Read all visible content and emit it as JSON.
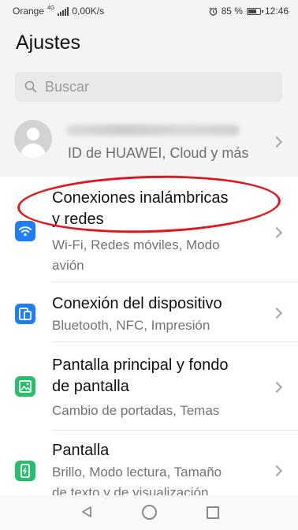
{
  "status_bar": {
    "carrier": "Orange",
    "network": "4G",
    "speed": "0,00K/s",
    "battery": "85 %",
    "battery_level": 0.85,
    "time": "12:46"
  },
  "header": {
    "title": "Ajustes",
    "search_placeholder": "Buscar"
  },
  "account": {
    "subtitle": "ID de HUAWEI, Cloud y más"
  },
  "items": [
    {
      "title_lines": [
        "Conexiones inalámbricas",
        "y redes"
      ],
      "subtitle_lines": [
        "Wi-Fi, Redes móviles, Modo",
        "avión"
      ],
      "icon": "wifi-icon",
      "color": "#1e7ef5"
    },
    {
      "title_lines": [
        "Conexión del dispositivo"
      ],
      "subtitle_lines": [
        "Bluetooth, NFC, Impresión"
      ],
      "icon": "device-connection-icon",
      "color": "#1e7ef5"
    },
    {
      "title_lines": [
        "Pantalla principal y fondo",
        "de pantalla"
      ],
      "subtitle_lines": [
        "Cambio de portadas, Temas"
      ],
      "icon": "wallpaper-icon",
      "color": "#2bbd6e"
    },
    {
      "title_lines": [
        "Pantalla"
      ],
      "subtitle_lines": [
        "Brillo, Modo lectura, Tamaño",
        "de texto y de visualización"
      ],
      "icon": "display-icon",
      "color": "#2bbd6e"
    }
  ],
  "annotation_color": "#e4161b"
}
